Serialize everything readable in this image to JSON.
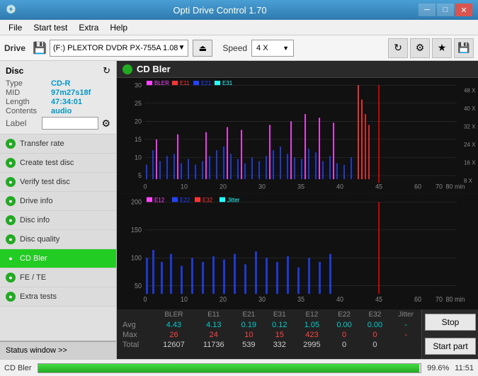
{
  "titleBar": {
    "title": "Opti Drive Control 1.70",
    "icon": "💿",
    "minimize": "─",
    "maximize": "□",
    "close": "✕"
  },
  "menuBar": {
    "items": [
      "File",
      "Start test",
      "Extra",
      "Help"
    ]
  },
  "driveBar": {
    "label": "Drive",
    "driveValue": "(F:)  PLEXTOR DVDR  PX-755A 1.08",
    "speedLabel": "Speed",
    "speedValue": "4 X"
  },
  "sidebar": {
    "discTitle": "Disc",
    "discInfo": {
      "type": {
        "key": "Type",
        "val": "CD-R"
      },
      "mid": {
        "key": "MID",
        "val": "97m27s18f"
      },
      "length": {
        "key": "Length",
        "val": "47:34:01"
      },
      "contents": {
        "key": "Contents",
        "val": "audio"
      },
      "label": {
        "key": "Label",
        "val": ""
      }
    },
    "menuItems": [
      {
        "id": "transfer-rate",
        "label": "Transfer rate",
        "active": false
      },
      {
        "id": "create-test-disc",
        "label": "Create test disc",
        "active": false
      },
      {
        "id": "verify-test-disc",
        "label": "Verify test disc",
        "active": false
      },
      {
        "id": "drive-info",
        "label": "Drive info",
        "active": false
      },
      {
        "id": "disc-info",
        "label": "Disc info",
        "active": false
      },
      {
        "id": "disc-quality",
        "label": "Disc quality",
        "active": false
      },
      {
        "id": "cd-bler",
        "label": "CD Bler",
        "active": true
      },
      {
        "id": "fe-te",
        "label": "FE / TE",
        "active": false
      },
      {
        "id": "extra-tests",
        "label": "Extra tests",
        "active": false
      }
    ],
    "statusWindow": "Status window >>"
  },
  "chartArea": {
    "title": "CD Bler",
    "chart1": {
      "legend": [
        {
          "label": "BLER",
          "color": "#ff00ff"
        },
        {
          "label": "E11",
          "color": "#ff2222"
        },
        {
          "label": "E21",
          "color": "#2222ff"
        },
        {
          "label": "E31",
          "color": "#22ffff"
        }
      ],
      "yMax": 30,
      "yAxisRight": [
        "48 X",
        "40 X",
        "32 X",
        "24 X",
        "16 X",
        "8 X"
      ]
    },
    "chart2": {
      "legend": [
        {
          "label": "E12",
          "color": "#ff00ff"
        },
        {
          "label": "E22",
          "color": "#2222ff"
        },
        {
          "label": "E32",
          "color": "#ff2222"
        },
        {
          "label": "Jitter",
          "color": "#22ffff"
        }
      ],
      "yMax": 200
    },
    "stats": {
      "headers": [
        "",
        "BLER",
        "E11",
        "E21",
        "E31",
        "E12",
        "E22",
        "E32",
        "Jitter"
      ],
      "rows": [
        {
          "label": "Avg",
          "vals": [
            "4.43",
            "4.13",
            "0.19",
            "0.12",
            "1.05",
            "0.00",
            "0.00",
            "-"
          ]
        },
        {
          "label": "Max",
          "vals": [
            "26",
            "24",
            "10",
            "15",
            "423",
            "0",
            "0",
            "-"
          ]
        },
        {
          "label": "Total",
          "vals": [
            "12607",
            "11736",
            "539",
            "332",
            "2995",
            "0",
            "0",
            ""
          ]
        }
      ]
    },
    "buttons": {
      "stop": "Stop",
      "startPart": "Start part"
    }
  },
  "statusBar": {
    "label": "CD Bler",
    "progress": 99.6,
    "progressText": "99.6%",
    "time": "11:51"
  }
}
